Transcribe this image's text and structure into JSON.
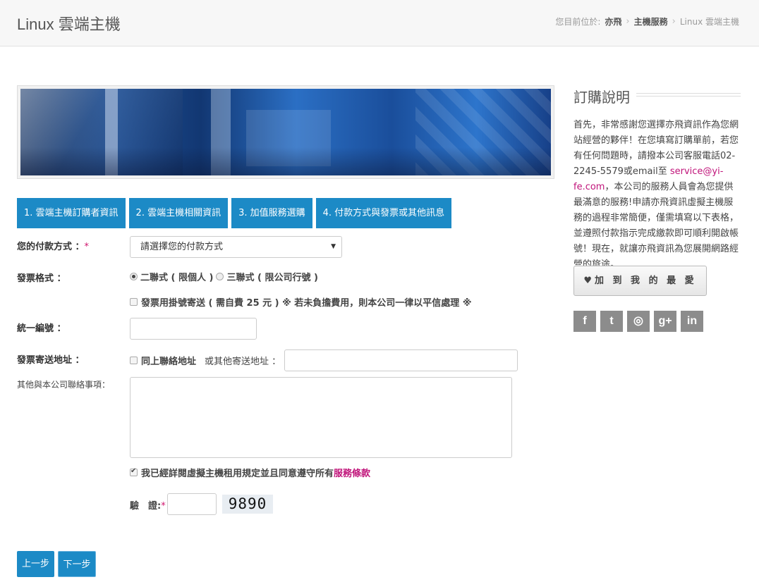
{
  "header": {
    "title": "Linux 雲端主機",
    "breadcrumb_prefix": "您目前位於:",
    "breadcrumb": [
      "亦飛",
      "主機服務",
      "Linux 雲端主機"
    ]
  },
  "tabs": [
    "1. 雲端主機訂購者資訊",
    "2. 雲端主機相關資訊",
    "3. 加值服務選購",
    "4. 付款方式與發票或其他訊息"
  ],
  "form": {
    "payment_label": "您的付款方式 ：",
    "payment_required": "*",
    "payment_selected": "請選擇您的付款方式",
    "invoice_label": "發票格式 ：",
    "invoice_options": [
      "二聯式 ( 限個人 )",
      "三聯式 ( 限公司行號 )"
    ],
    "invoice_selected_index": 0,
    "registered_mail_text": "發票用掛號寄送 ( 需自費 25 元 ) ※ 若未負擔費用，則本公司一律以平信處理 ※",
    "tax_id_label": "統一編號 ：",
    "address_label": "發票寄送地址 ：",
    "same_as_contact": "同上聯絡地址",
    "other_address": "或其他寄送地址 ：",
    "notes_label": "其他與本公司聯絡事項：",
    "agree_text": "我已經詳閱虛擬主機租用規定並且同意遵守所有",
    "agree_link": "服務條款",
    "agree_checked": true,
    "captcha_label": "驗　證:",
    "captcha_required": "*",
    "captcha_code": "9890"
  },
  "buttons": {
    "prev": "上一步",
    "next": "下一步"
  },
  "sidebar": {
    "title": "訂購說明",
    "text_before": "首先，非常感謝您選擇亦飛資訊作為您網站經營的夥伴！在您填寫訂購單前，若您有任何問題時，請撥本公司客服電話02-2245-5579或email至 ",
    "email": "service@yi-fe.com",
    "text_after": "，本公司的服務人員會為您提供最滿意的服務!申請亦飛資訊虛擬主機服務的過程非常簡便，僅需填寫以下表格，並遵照付款指示完成繳款即可順利開啟帳號！現在，就讓亦飛資訊為您展開網路經營的旅途。",
    "favorite_button": "加 到 我 的 最 愛",
    "social": [
      "f",
      "t",
      "◎",
      "g+",
      "in"
    ]
  },
  "colors": {
    "accent": "#1c8ac6",
    "link": "#c0147a"
  }
}
